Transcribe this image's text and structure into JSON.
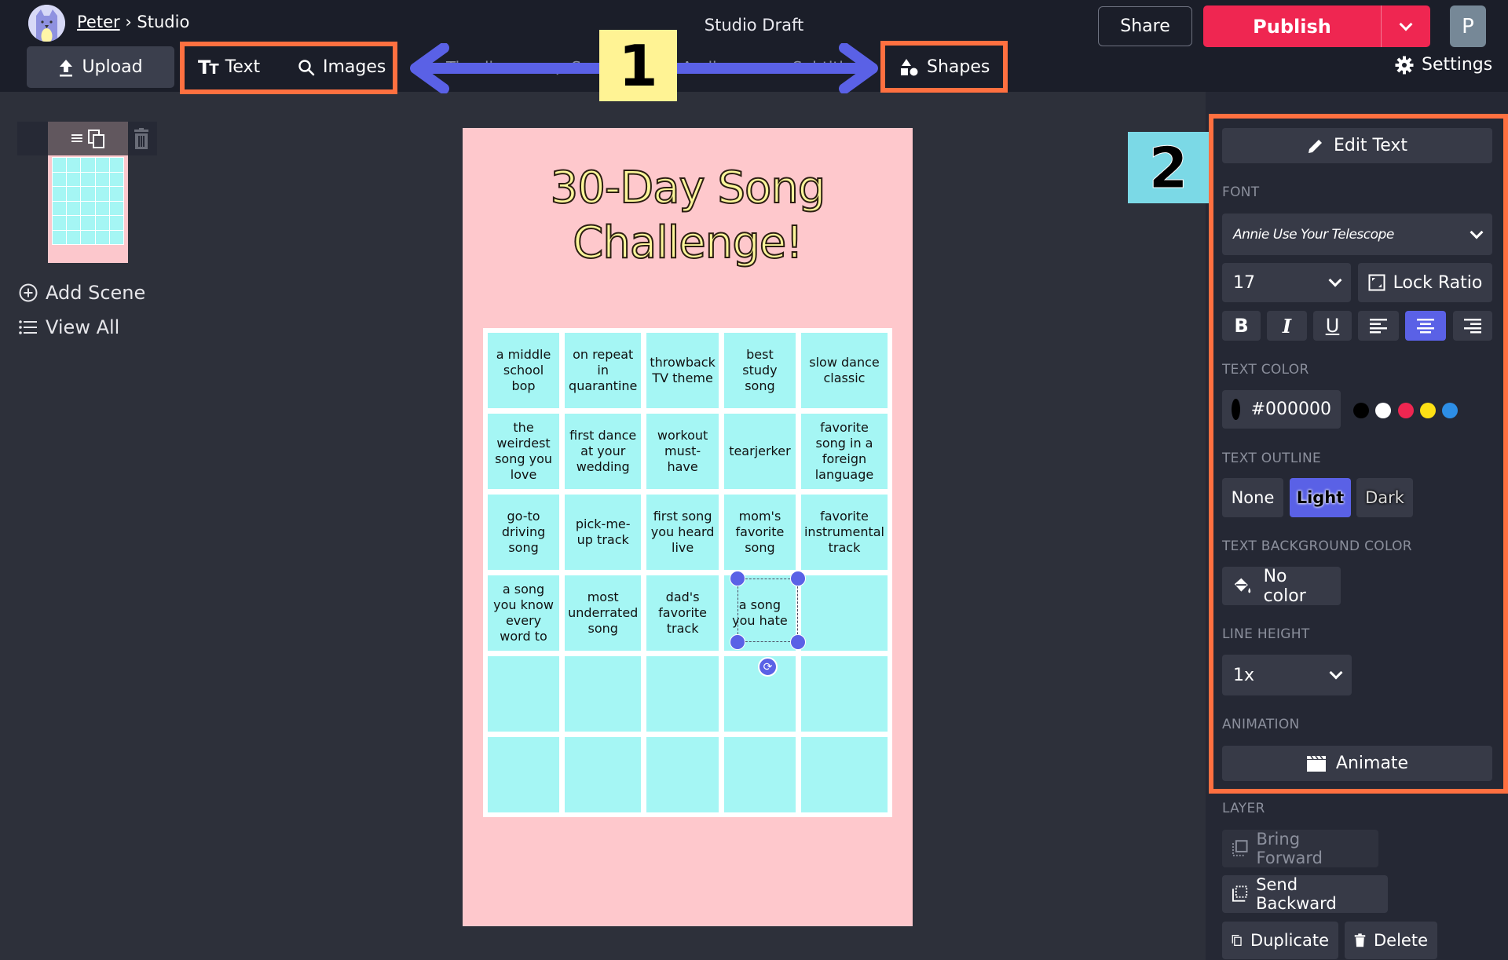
{
  "header": {
    "user_name": "Peter",
    "breadcrumb_separator": "›",
    "breadcrumb_current": "Studio",
    "document_title": "Studio Draft",
    "share_label": "Share",
    "publish_label": "Publish",
    "user_initial": "P",
    "settings_label": "Settings"
  },
  "toolbar": {
    "upload_label": "Upload",
    "tools": [
      {
        "label": "Text",
        "icon": "text-size-icon"
      },
      {
        "label": "Images",
        "icon": "search-icon"
      },
      {
        "label": "Timeline",
        "icon": "none"
      },
      {
        "label": "S",
        "icon": "layers-icon"
      },
      {
        "label": "Audio",
        "icon": "music-icon"
      },
      {
        "label": "Subtitles",
        "icon": "subtitles-icon"
      },
      {
        "label": "Shapes",
        "icon": "shapes-icon"
      }
    ]
  },
  "annotations": {
    "badge_1": "1",
    "badge_2": "2",
    "box_color": "#ff7040",
    "arrow_color": "#5a61e6"
  },
  "sidebar": {
    "add_scene_label": "Add Scene",
    "view_all_label": "View All"
  },
  "canvas": {
    "title_line1": "30-Day Song",
    "title_line2": "Challenge!",
    "background_color": "#fec8cc",
    "cell_color": "#a5f6f4",
    "cells": [
      "a middle school bop",
      "on repeat in quarantine",
      "throwback TV theme",
      "best study song",
      "slow dance classic",
      "the weirdest song you love",
      "first dance at your wedding",
      "workout must-have",
      "tearjerker",
      "favorite song in a foreign language",
      "go-to driving song",
      "pick-me-up track",
      "first song you heard live",
      "mom's favorite song",
      "favorite instrumental track",
      "a song you know every word to",
      "most underrated song",
      "dad's favorite track",
      "a song you hate",
      "",
      "",
      "",
      "",
      "",
      "",
      "",
      "",
      "",
      "",
      ""
    ],
    "selected_cell_index": 18
  },
  "panel": {
    "edit_text_label": "Edit Text",
    "font_label": "FONT",
    "font_value": "Annie Use Your Telescope",
    "font_size_value": "17",
    "lock_ratio_label": "Lock Ratio",
    "format_buttons": [
      {
        "label": "B",
        "name": "bold",
        "active": false
      },
      {
        "label": "I",
        "name": "italic",
        "active": false
      },
      {
        "label": "U",
        "name": "underline",
        "active": false
      },
      {
        "label": "left",
        "name": "align-left",
        "active": false
      },
      {
        "label": "center",
        "name": "align-center",
        "active": true
      },
      {
        "label": "right",
        "name": "align-right",
        "active": false
      }
    ],
    "text_color_label": "TEXT COLOR",
    "text_color_value": "#000000",
    "swatches": [
      "#000000",
      "#ffffff",
      "#ef2651",
      "#fde014",
      "#2d8ee6"
    ],
    "text_outline_label": "TEXT OUTLINE",
    "outline_options": [
      "None",
      "Light",
      "Dark"
    ],
    "outline_selected": "Light",
    "text_bg_label": "TEXT BACKGROUND COLOR",
    "text_bg_value": "No color",
    "line_height_label": "LINE HEIGHT",
    "line_height_value": "1x",
    "animation_label": "ANIMATION",
    "animate_label": "Animate",
    "layer_label": "LAYER",
    "bring_forward_label": "Bring Forward",
    "send_backward_label": "Send Backward",
    "duplicate_label": "Duplicate",
    "delete_label": "Delete"
  }
}
